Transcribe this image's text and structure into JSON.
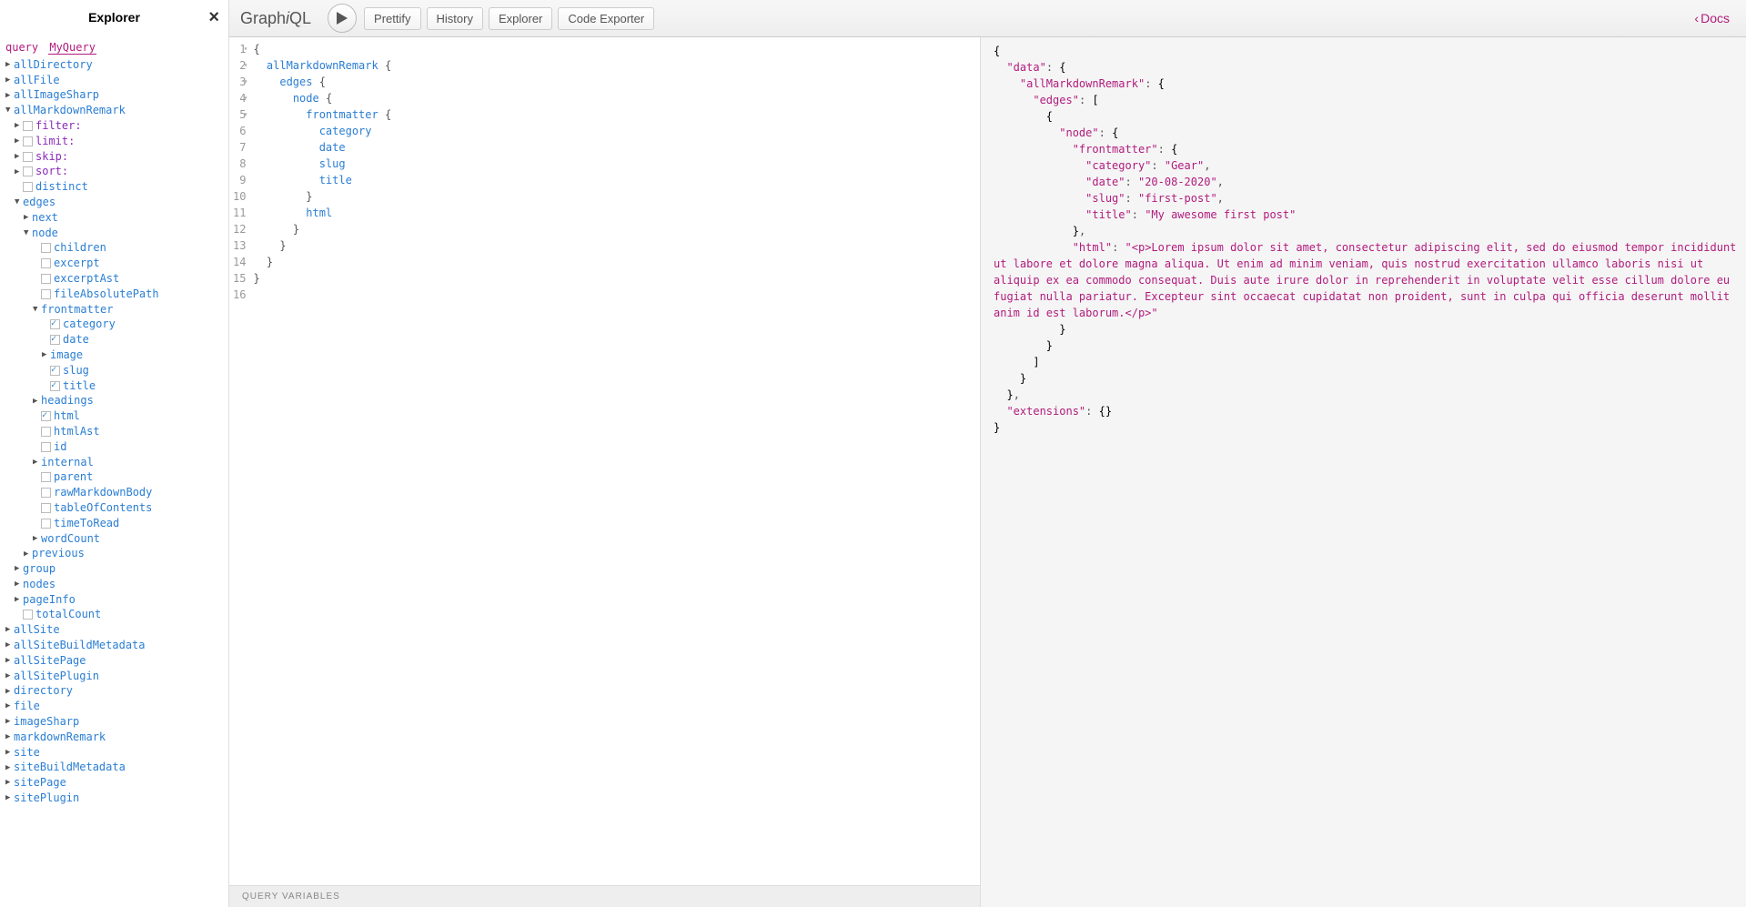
{
  "explorer": {
    "title": "Explorer",
    "query_keyword": "query",
    "query_name": "MyQuery",
    "root_fields": [
      "allDirectory",
      "allFile",
      "allImageSharp",
      "allMarkdownRemark",
      "allSite",
      "allSiteBuildMetadata",
      "allSitePage",
      "allSitePlugin",
      "directory",
      "file",
      "imageSharp",
      "markdownRemark",
      "site",
      "siteBuildMetadata",
      "sitePage",
      "sitePlugin"
    ],
    "amr_params": [
      "filter:",
      "limit:",
      "skip:",
      "sort:"
    ],
    "amr_children": [
      "distinct",
      "edges",
      "group",
      "nodes",
      "pageInfo",
      "totalCount"
    ],
    "edges_children": [
      "next",
      "node",
      "previous"
    ],
    "node_children": [
      "children",
      "excerpt",
      "excerptAst",
      "fileAbsolutePath",
      "frontmatter",
      "headings",
      "html",
      "htmlAst",
      "id",
      "internal",
      "parent",
      "rawMarkdownBody",
      "tableOfContents",
      "timeToRead",
      "wordCount"
    ],
    "frontmatter_children": [
      "category",
      "date",
      "image",
      "slug",
      "title"
    ],
    "checked_fm": {
      "category": true,
      "date": true,
      "slug": true,
      "title": true
    },
    "checked_node": {
      "html": true
    }
  },
  "topbar": {
    "logo_a": "Graph",
    "logo_i": "i",
    "logo_b": "QL",
    "buttons": [
      "Prettify",
      "History",
      "Explorer",
      "Code Exporter"
    ],
    "docs": "Docs"
  },
  "editor": {
    "lines": [
      {
        "n": 1,
        "fold": true,
        "t": "{",
        "cls": ""
      },
      {
        "n": 2,
        "fold": true,
        "t": "  allMarkdownRemark {",
        "cls": "f"
      },
      {
        "n": 3,
        "fold": true,
        "t": "    edges {",
        "cls": "f"
      },
      {
        "n": 4,
        "fold": true,
        "t": "      node {",
        "cls": "f"
      },
      {
        "n": 5,
        "fold": true,
        "t": "        frontmatter {",
        "cls": "f"
      },
      {
        "n": 6,
        "fold": false,
        "t": "          category",
        "cls": "f"
      },
      {
        "n": 7,
        "fold": false,
        "t": "          date",
        "cls": "f"
      },
      {
        "n": 8,
        "fold": false,
        "t": "          slug",
        "cls": "f"
      },
      {
        "n": 9,
        "fold": false,
        "t": "          title",
        "cls": "f"
      },
      {
        "n": 10,
        "fold": false,
        "t": "        }",
        "cls": ""
      },
      {
        "n": 11,
        "fold": false,
        "t": "        html",
        "cls": "f"
      },
      {
        "n": 12,
        "fold": false,
        "t": "      }",
        "cls": ""
      },
      {
        "n": 13,
        "fold": false,
        "t": "    }",
        "cls": ""
      },
      {
        "n": 14,
        "fold": false,
        "t": "  }",
        "cls": ""
      },
      {
        "n": 15,
        "fold": false,
        "t": "}",
        "cls": ""
      },
      {
        "n": 16,
        "fold": false,
        "t": "",
        "cls": ""
      }
    ],
    "vars_label": "Query Variables"
  },
  "result": {
    "data": {
      "allMarkdownRemark": {
        "edges": [
          {
            "node": {
              "frontmatter": {
                "category": "Gear",
                "date": "20-08-2020",
                "slug": "first-post",
                "title": "My awesome first post"
              },
              "html": "<p>Lorem ipsum dolor sit amet, consectetur adipiscing elit, sed do eiusmod tempor incididunt ut labore et dolore magna aliqua. Ut enim ad minim veniam, quis nostrud exercitation ullamco laboris nisi ut aliquip ex ea commodo consequat. Duis aute irure dolor in reprehenderit in voluptate velit esse cillum dolore eu fugiat nulla pariatur. Excepteur sint occaecat cupidatat non proident, sunt in culpa qui officia deserunt mollit anim id est laborum.</p>"
            }
          }
        ]
      }
    },
    "extensions": {}
  }
}
